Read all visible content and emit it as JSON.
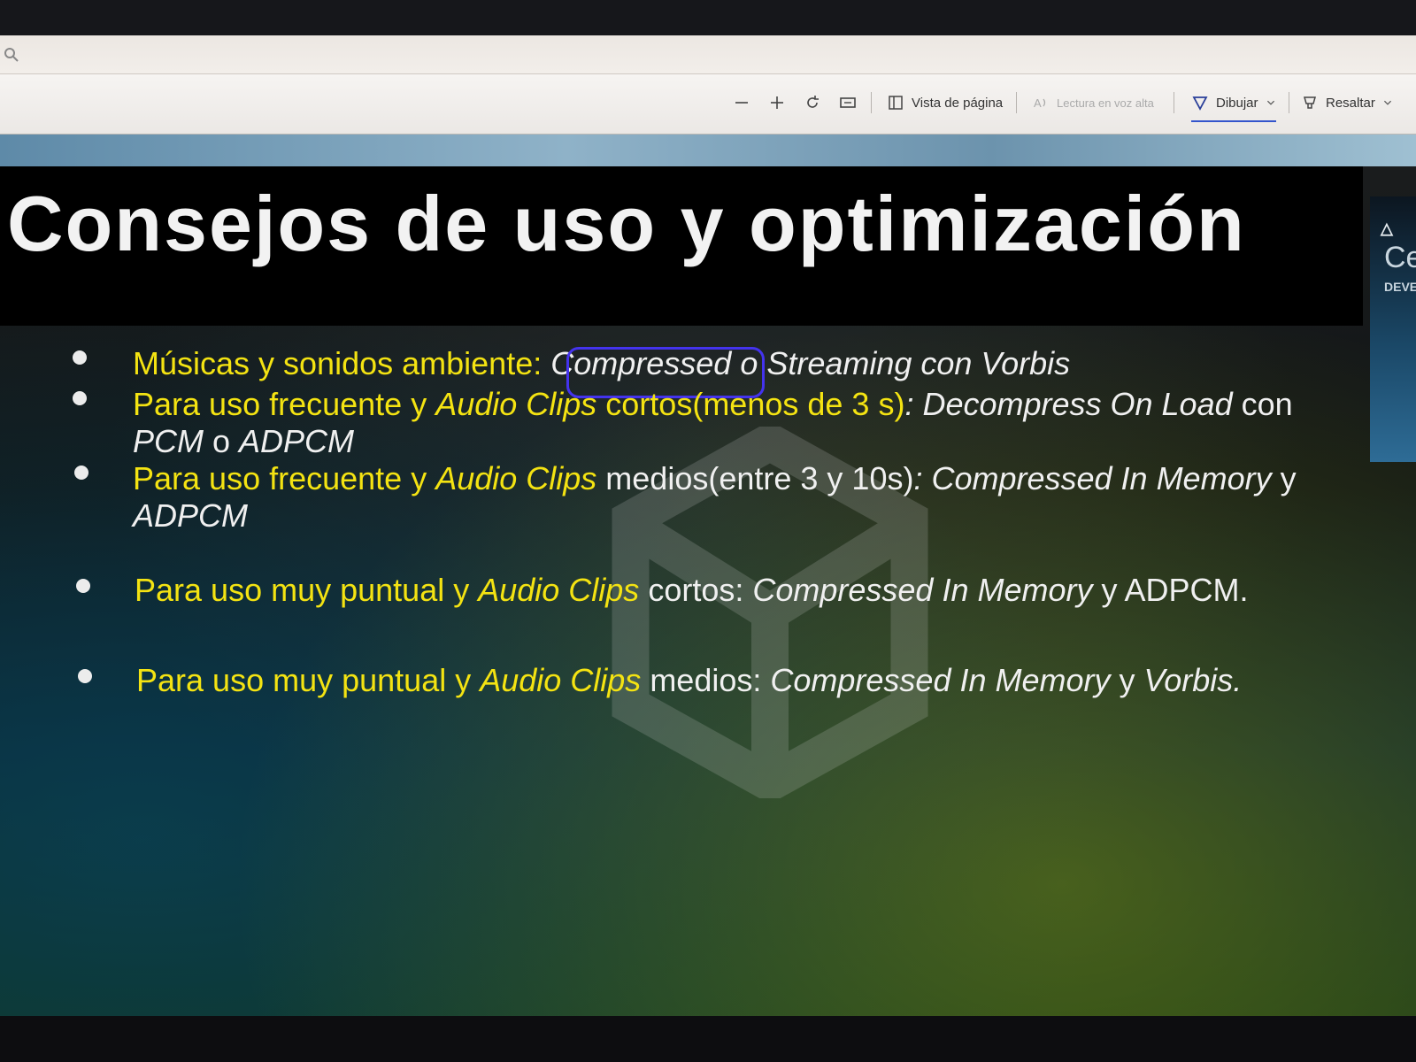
{
  "toolbar": {
    "vista_label": "Vista de página",
    "lectura_label": "Lectura en voz alta",
    "dibujar_label": "Dibujar",
    "resaltar_label": "Resaltar"
  },
  "slide": {
    "title": "Consejos de uso y optimización",
    "badge_ce": "Ce",
    "badge_dev": "DEVE",
    "bullets": [
      {
        "a": "Músicas y sonidos ambiente: ",
        "b": "Compressed",
        "c": " o Streaming con Vorbis"
      },
      {
        "a": "Para uso frecuente y ",
        "b": "Audio Clips",
        "c": " cortos(menos de 3 s)",
        "d": ": Decompress On Load",
        "e": " con",
        "f": "PCM",
        "g": " o ",
        "h": "ADPCM"
      },
      {
        "a": "Para uso frecuente y ",
        "b": "Audio Clips",
        "c": " medios(entre 3 y 10s)",
        "d": ": Compressed In Memory",
        "e": " y",
        "f": "ADPCM"
      },
      {
        "a": "Para uso muy puntual y ",
        "b": "Audio Clips",
        "c": " cortos",
        "d": ": ",
        "e": "Compressed In Memory",
        "f": " y ADPCM."
      },
      {
        "a": "Para uso muy puntual y ",
        "b": "Audio Clips",
        "c": " medios",
        "d": ": ",
        "e": "Compressed In Memory",
        "f": "  y ",
        "g": "Vorbis."
      }
    ]
  },
  "colors": {
    "accent_yellow": "#f4e312",
    "annotation_blue": "#4433ee",
    "draw_underline": "#3355cc"
  }
}
